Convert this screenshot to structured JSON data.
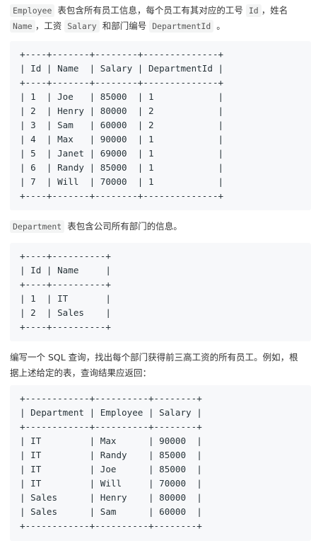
{
  "intro1": {
    "t1": "Employee",
    "t2": " 表包含所有员工信息，每个员工有其对应的工号 ",
    "t3": "Id",
    "t4": "，姓名 ",
    "t5": "Name",
    "t6": "，工资 ",
    "t7": "Salary",
    "t8": " 和部门编号 ",
    "t9": "DepartmentId",
    "t10": " 。"
  },
  "employee_table": [
    "+----+-------+--------+--------------+",
    "| Id | Name  | Salary | DepartmentId |",
    "+----+-------+--------+--------------+",
    "| 1  | Joe   | 85000  | 1            |",
    "| 2  | Henry | 80000  | 2            |",
    "| 3  | Sam   | 60000  | 2            |",
    "| 4  | Max   | 90000  | 1            |",
    "| 5  | Janet | 69000  | 1            |",
    "| 6  | Randy | 85000  | 1            |",
    "| 7  | Will  | 70000  | 1            |",
    "+----+-------+--------+--------------+"
  ],
  "intro2": {
    "t1": "Department",
    "t2": " 表包含公司所有部门的信息。"
  },
  "department_table": [
    "+----+----------+",
    "| Id | Name     |",
    "+----+----------+",
    "| 1  | IT       |",
    "| 2  | Sales    |",
    "+----+----------+"
  ],
  "question": "编写一个 SQL 查询，找出每个部门获得前三高工资的所有员工。例如，根据上述给定的表，查询结果应返回：",
  "result_table": [
    "+------------+----------+--------+",
    "| Department | Employee | Salary |",
    "+------------+----------+--------+",
    "| IT         | Max      | 90000  |",
    "| IT         | Randy    | 85000  |",
    "| IT         | Joe      | 85000  |",
    "| IT         | Will     | 70000  |",
    "| Sales      | Henry    | 80000  |",
    "| Sales      | Sam      | 60000  |",
    "+------------+----------+--------+"
  ]
}
